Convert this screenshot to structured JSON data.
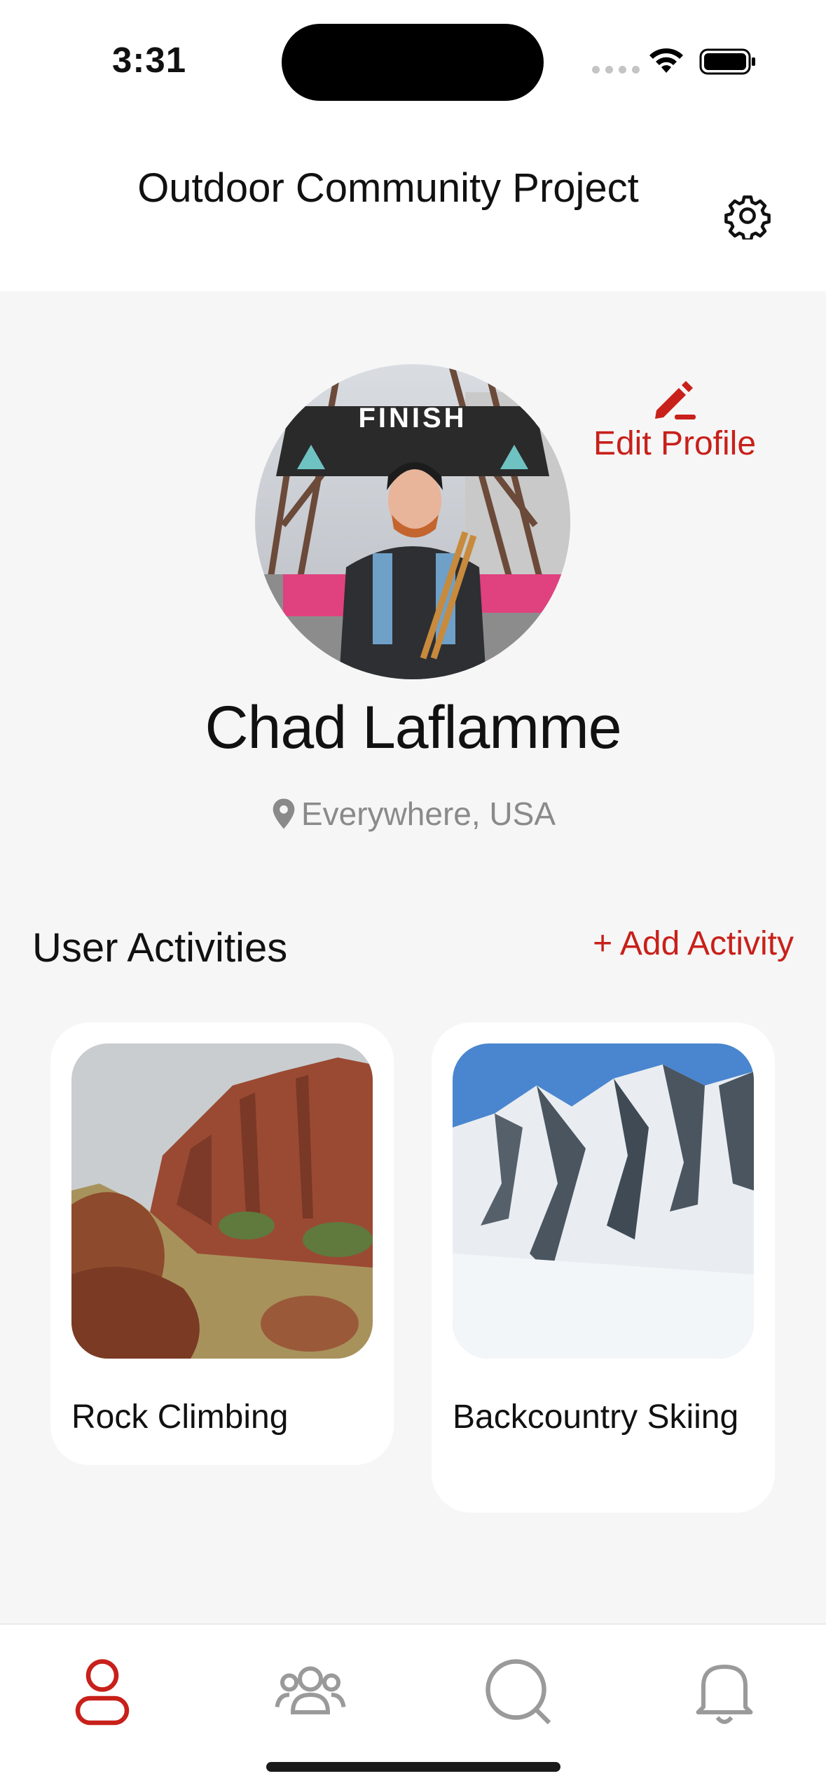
{
  "status_bar": {
    "time": "3:31"
  },
  "header": {
    "title": "Outdoor Community Project",
    "settings_icon": "gear-icon"
  },
  "profile": {
    "name": "Chad Laflamme",
    "location": "Everywhere, USA",
    "edit_label": "Edit Profile",
    "avatar_sign": "FINISH"
  },
  "activities": {
    "title": "User Activities",
    "add_label": "+ Add Activity",
    "items": [
      {
        "label": "Rock Climbing"
      },
      {
        "label": "Backcountry Skiing"
      }
    ]
  },
  "tabbar": {
    "items": [
      {
        "icon": "person-icon",
        "active": true
      },
      {
        "icon": "group-icon",
        "active": false
      },
      {
        "icon": "search-icon",
        "active": false
      },
      {
        "icon": "bell-icon",
        "active": false
      }
    ]
  },
  "colors": {
    "accent": "#c8201a",
    "muted": "#8a8a8a",
    "background": "#f6f6f6"
  }
}
